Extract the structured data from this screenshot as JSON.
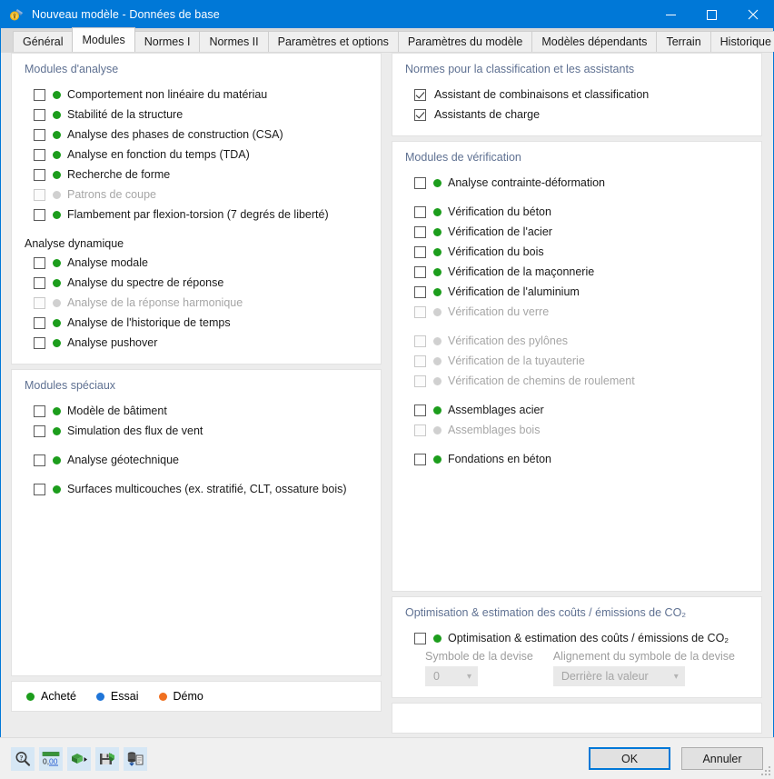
{
  "window": {
    "title": "Nouveau modèle - Données de base",
    "icon": "app-lock-icon",
    "minimize": "–",
    "maximize": "☐",
    "close": "✕"
  },
  "tabs": [
    {
      "label": "Général",
      "active": false
    },
    {
      "label": "Modules",
      "active": true
    },
    {
      "label": "Normes I",
      "active": false
    },
    {
      "label": "Normes II",
      "active": false
    },
    {
      "label": "Paramètres et options",
      "active": false
    },
    {
      "label": "Paramètres du modèle",
      "active": false
    },
    {
      "label": "Modèles dépendants",
      "active": false
    },
    {
      "label": "Terrain",
      "active": false
    },
    {
      "label": "Historique",
      "active": false
    }
  ],
  "colors": {
    "accent": "#0078d7",
    "purchased": "#1c9d1c",
    "trial": "#1f75d8",
    "demo": "#f07020",
    "disabled_dot": "#d0d0d0",
    "group_title": "#5f7192"
  },
  "left": {
    "analysis": {
      "title": "Modules d'analyse",
      "items": [
        {
          "label": "Comportement non linéaire du matériau",
          "checked": false,
          "disabled": false,
          "status": "purchased"
        },
        {
          "label": "Stabilité de la structure",
          "checked": false,
          "disabled": false,
          "status": "purchased"
        },
        {
          "label": "Analyse des phases de construction (CSA)",
          "checked": false,
          "disabled": false,
          "status": "purchased"
        },
        {
          "label": "Analyse en fonction du temps (TDA)",
          "checked": false,
          "disabled": false,
          "status": "purchased"
        },
        {
          "label": "Recherche de forme",
          "checked": false,
          "disabled": false,
          "status": "purchased"
        },
        {
          "label": "Patrons de coupe",
          "checked": false,
          "disabled": true,
          "status": "disabled"
        },
        {
          "label": "Flambement par flexion-torsion (7 degrés de liberté)",
          "checked": false,
          "disabled": false,
          "status": "purchased"
        }
      ],
      "dynamic_title": "Analyse dynamique",
      "dynamic_items": [
        {
          "label": "Analyse modale",
          "checked": false,
          "disabled": false,
          "status": "purchased"
        },
        {
          "label": "Analyse du spectre de réponse",
          "checked": false,
          "disabled": false,
          "status": "purchased"
        },
        {
          "label": "Analyse de la réponse harmonique",
          "checked": false,
          "disabled": true,
          "status": "disabled"
        },
        {
          "label": "Analyse de l'historique de temps",
          "checked": false,
          "disabled": false,
          "status": "purchased"
        },
        {
          "label": "Analyse pushover",
          "checked": false,
          "disabled": false,
          "status": "purchased"
        }
      ]
    },
    "special": {
      "title": "Modules spéciaux",
      "items": [
        {
          "label": "Modèle de bâtiment",
          "checked": false,
          "disabled": false,
          "status": "purchased",
          "gap": false
        },
        {
          "label": "Simulation des flux de vent",
          "checked": false,
          "disabled": false,
          "status": "purchased",
          "gap": false
        },
        {
          "label": "Analyse géotechnique",
          "checked": false,
          "disabled": false,
          "status": "purchased",
          "gap": true
        },
        {
          "label": "Surfaces multicouches (ex. stratifié, CLT, ossature bois)",
          "checked": false,
          "disabled": false,
          "status": "purchased",
          "gap": true
        }
      ]
    },
    "legend": {
      "items": [
        {
          "label": "Acheté",
          "status": "purchased"
        },
        {
          "label": "Essai",
          "status": "trial"
        },
        {
          "label": "Démo",
          "status": "demo"
        }
      ]
    }
  },
  "right": {
    "standards": {
      "title": "Normes pour la classification et les assistants",
      "items": [
        {
          "label": "Assistant de combinaisons et classification",
          "checked": true,
          "disabled": false,
          "status": "none"
        },
        {
          "label": "Assistants de charge",
          "checked": true,
          "disabled": false,
          "status": "none"
        }
      ]
    },
    "design": {
      "title": "Modules de vérification",
      "items": [
        {
          "label": "Analyse contrainte-déformation",
          "checked": false,
          "disabled": false,
          "status": "purchased",
          "gap": false
        },
        {
          "label": "Vérification du béton",
          "checked": false,
          "disabled": false,
          "status": "purchased",
          "gap": true
        },
        {
          "label": "Vérification de l'acier",
          "checked": false,
          "disabled": false,
          "status": "purchased",
          "gap": false
        },
        {
          "label": "Vérification du bois",
          "checked": false,
          "disabled": false,
          "status": "purchased",
          "gap": false
        },
        {
          "label": "Vérification de la maçonnerie",
          "checked": false,
          "disabled": false,
          "status": "purchased",
          "gap": false
        },
        {
          "label": "Vérification de l'aluminium",
          "checked": false,
          "disabled": false,
          "status": "purchased",
          "gap": false
        },
        {
          "label": "Vérification du verre",
          "checked": false,
          "disabled": true,
          "status": "disabled",
          "gap": false
        },
        {
          "label": "Vérification des pylônes",
          "checked": false,
          "disabled": true,
          "status": "disabled",
          "gap": true
        },
        {
          "label": "Vérification de la tuyauterie",
          "checked": false,
          "disabled": true,
          "status": "disabled",
          "gap": false
        },
        {
          "label": "Vérification de chemins de roulement",
          "checked": false,
          "disabled": true,
          "status": "disabled",
          "gap": false
        },
        {
          "label": "Assemblages acier",
          "checked": false,
          "disabled": false,
          "status": "purchased",
          "gap": true
        },
        {
          "label": "Assemblages bois",
          "checked": false,
          "disabled": true,
          "status": "disabled",
          "gap": false
        },
        {
          "label": "Fondations en béton",
          "checked": false,
          "disabled": false,
          "status": "purchased",
          "gap": true
        }
      ]
    },
    "co2": {
      "title": "Optimisation & estimation des coûts / émissions de CO₂",
      "checkbox_label": "Optimisation & estimation des coûts / émissions de CO₂",
      "checked": false,
      "status": "purchased",
      "currency_symbol_label": "Symbole de la devise",
      "currency_symbol_value": "0",
      "currency_align_label": "Alignement du symbole de la devise",
      "currency_align_value": "Derrière la valeur"
    }
  },
  "footer": {
    "tools": [
      {
        "name": "help-magnifier-icon"
      },
      {
        "name": "number-format-icon",
        "text": "0,00"
      },
      {
        "name": "export-icon"
      },
      {
        "name": "save-settings-icon"
      },
      {
        "name": "database-document-icon"
      }
    ],
    "ok_label": "OK",
    "cancel_label": "Annuler"
  }
}
